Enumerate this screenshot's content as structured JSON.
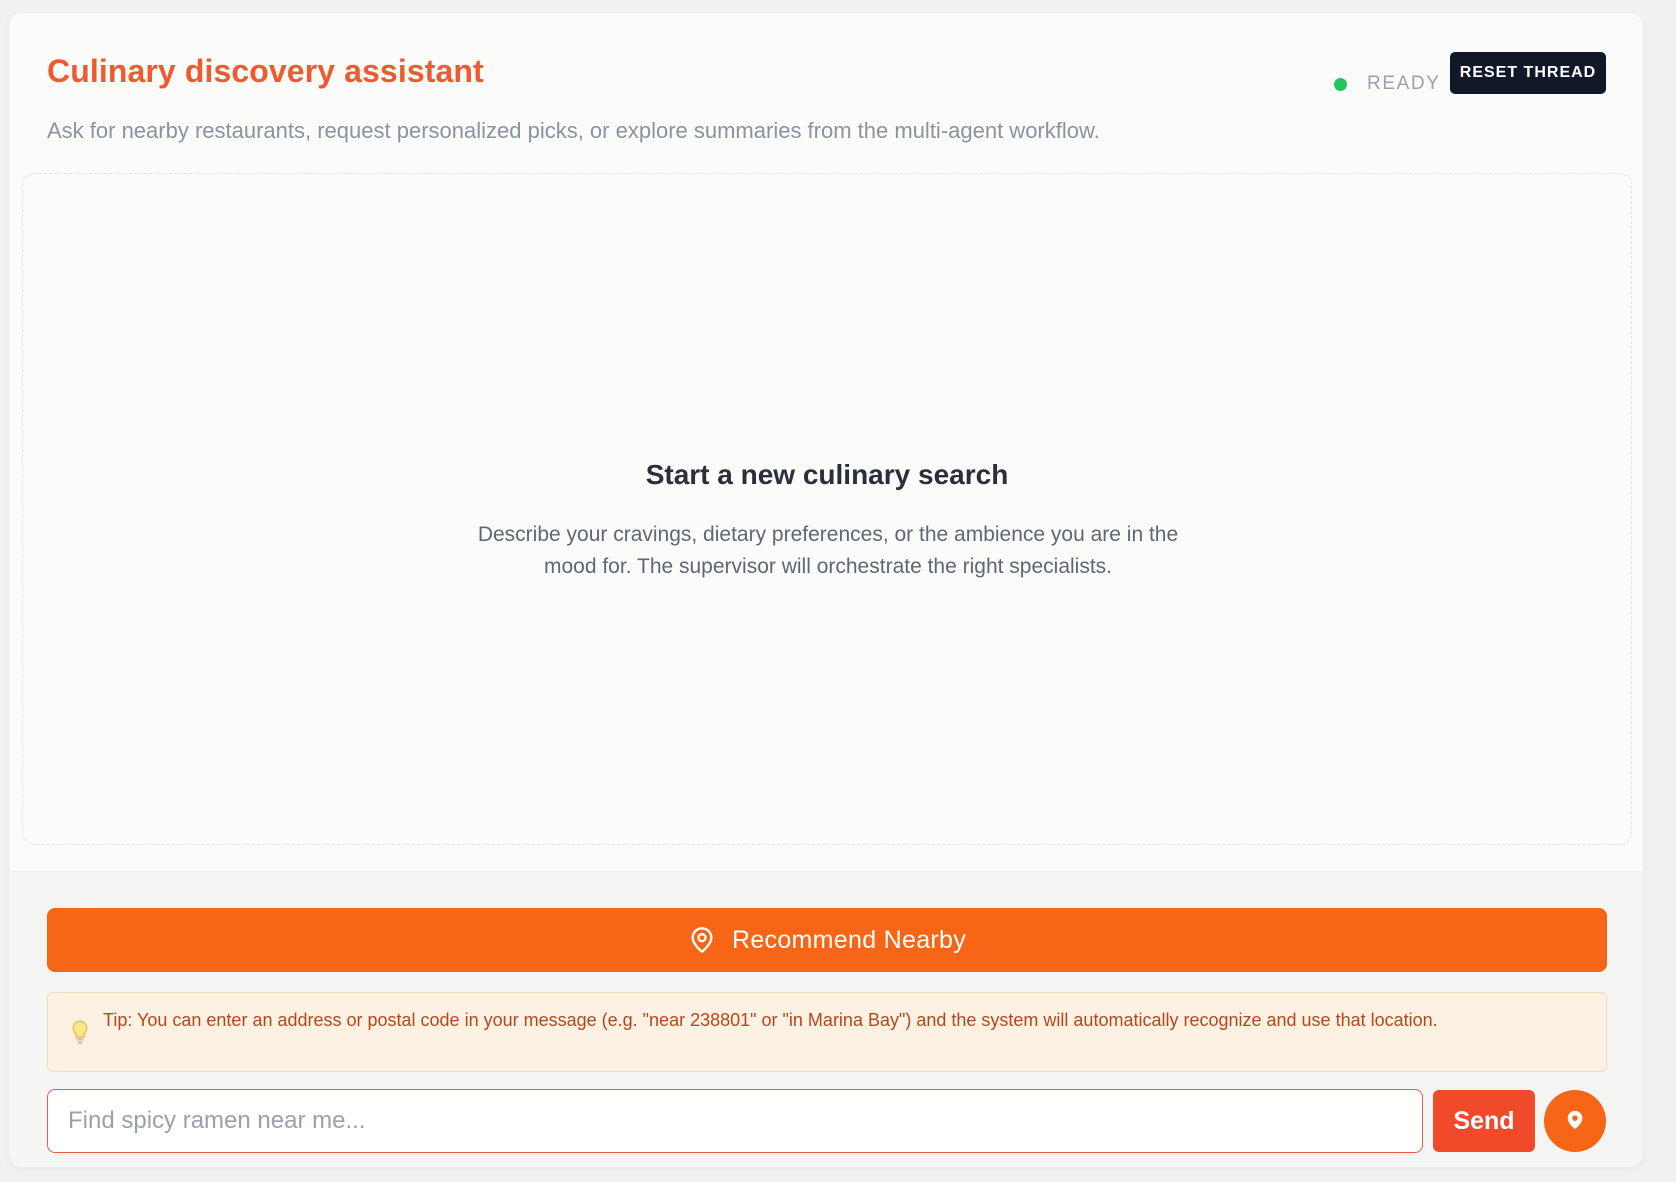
{
  "header": {
    "title": "Culinary discovery assistant",
    "subtitle": "Ask for nearby restaurants, request personalized picks, or explore summaries from the multi-agent workflow.",
    "status": "READY",
    "status_color": "#22c55e",
    "reset_label": "RESET THREAD"
  },
  "empty_state": {
    "title": "Start a new culinary search",
    "description": "Describe your cravings, dietary preferences, or the ambience you are in the mood for. The supervisor will orchestrate the right specialists."
  },
  "footer": {
    "recommend_label": "Recommend Nearby",
    "recommend_icon": "map-pin-outline-icon",
    "tip_icon": "lightbulb-icon",
    "tip_text": "Tip: You can enter an address or postal code in your message (e.g. \"near 238801\" or \"in Marina Bay\") and the system will automatically recognize and use that location.",
    "input_placeholder": "Find spicy ramen near me...",
    "input_value": "",
    "send_label": "Send",
    "location_icon": "map-pin-filled-icon"
  },
  "colors": {
    "accent": "#f76516",
    "title": "#ef5a2e",
    "send": "#f04a2a",
    "dark": "#111827"
  }
}
